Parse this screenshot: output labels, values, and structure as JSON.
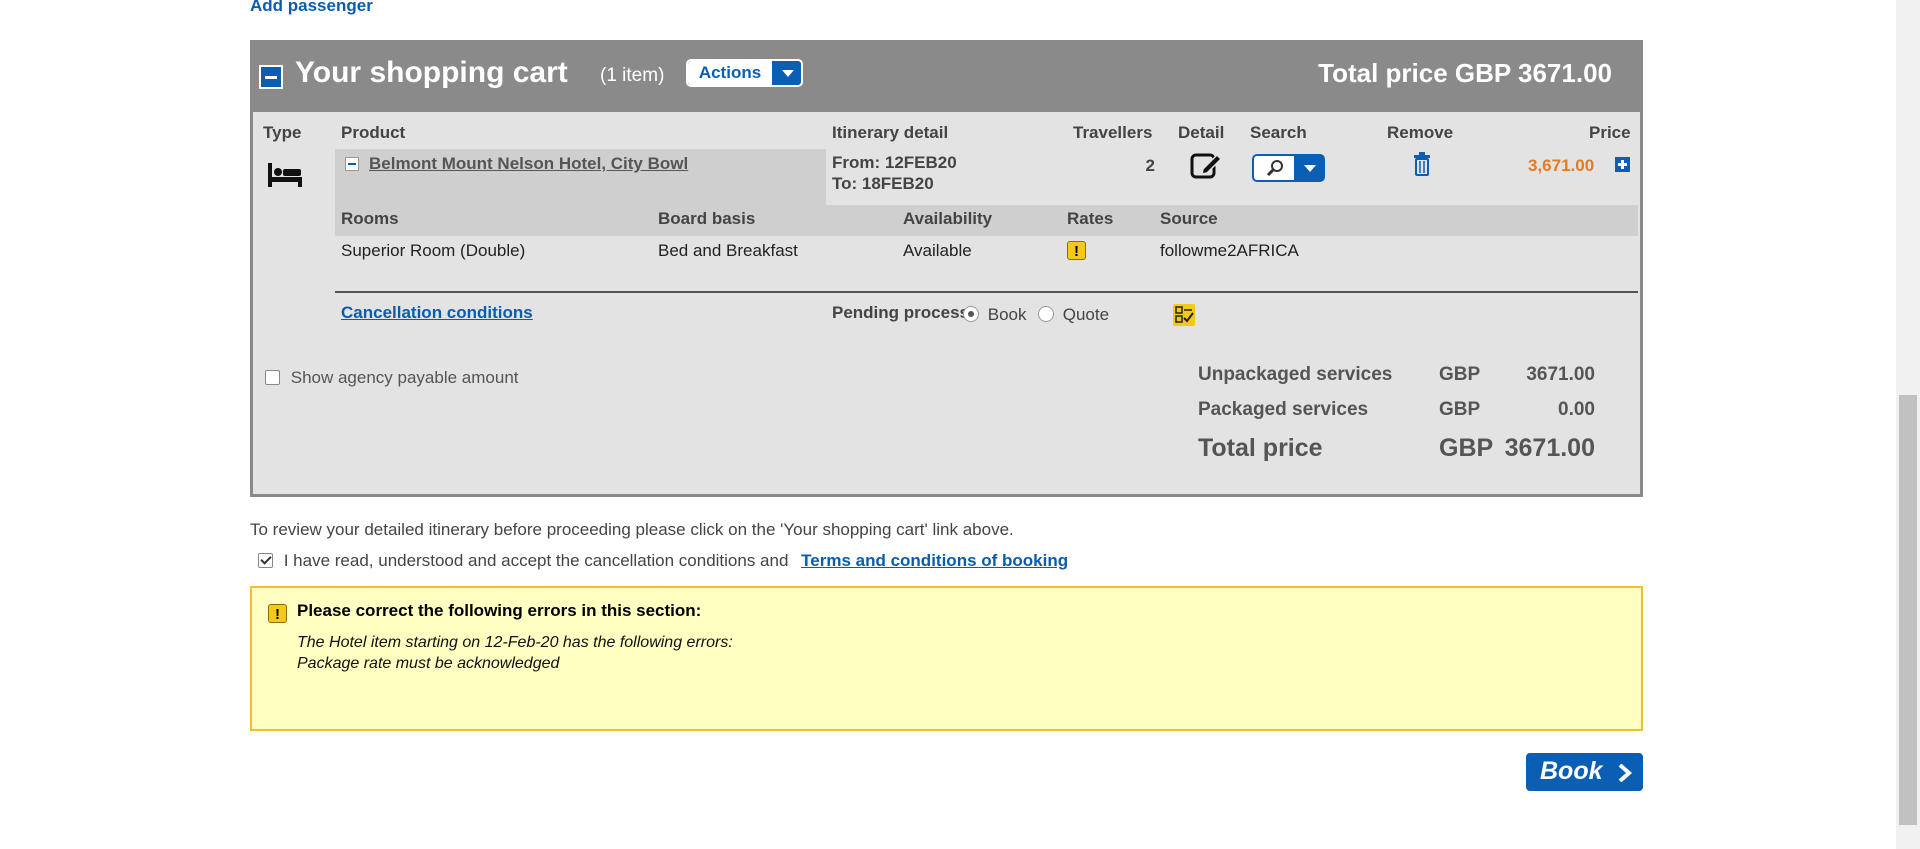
{
  "top": {
    "add_passenger": "Add passenger"
  },
  "cart": {
    "title": "Your shopping cart",
    "count": "(1 item)",
    "actions_label": "Actions",
    "total_label": "Total price",
    "total_value": "GBP 3671.00",
    "columns": {
      "type": "Type",
      "product": "Product",
      "itinerary": "Itinerary detail",
      "travellers": "Travellers",
      "detail": "Detail",
      "search": "Search",
      "remove": "Remove",
      "price": "Price"
    },
    "item": {
      "type_icon": "bed-icon",
      "product_name": "Belmont Mount Nelson Hotel, City Bowl",
      "from": "From: 12FEB20",
      "to": "To: 18FEB20",
      "travellers": "2",
      "price": "3,671.00"
    },
    "sub_columns": {
      "rooms": "Rooms",
      "board": "Board basis",
      "availability": "Availability",
      "rates": "Rates",
      "source": "Source"
    },
    "room": {
      "room": "Superior Room (Double)",
      "board": "Bed and Breakfast",
      "availability": "Available",
      "rates_icon": "warning-icon",
      "rates_glyph": "!",
      "source": "followme2AFRICA"
    },
    "cancellation_link": "Cancellation conditions",
    "pending_label": "Pending process:",
    "pending_book": "Book",
    "pending_quote": "Quote",
    "pending_selected": "Book",
    "show_agency_label": "Show agency payable amount",
    "summary": {
      "unpackaged_label": "Unpackaged services",
      "unpackaged_currency": "GBP",
      "unpackaged_value": "3671.00",
      "packaged_label": "Packaged services",
      "packaged_currency": "GBP",
      "packaged_value": "0.00",
      "total_label": "Total price",
      "total_currency": "GBP",
      "total_value": "3671.00"
    }
  },
  "notice": "To review your detailed itinerary before proceeding please click on the 'Your shopping cart' link above.",
  "accept": {
    "text": "I have read, understood and accept the cancellation conditions and",
    "link": "Terms and conditions of booking",
    "checked": true
  },
  "error": {
    "icon_glyph": "!",
    "title": "Please correct the following errors in this section:",
    "line1": "The Hotel item starting on 12-Feb-20 has the following errors:",
    "line2": "Package rate must be acknowledged"
  },
  "book_button": "Book",
  "colors": {
    "primary": "#0a5fb4",
    "header_gray": "#8a8a8a",
    "price_orange": "#e87a1e",
    "error_bg": "#ffffc2",
    "warning": "#f5c81a"
  }
}
